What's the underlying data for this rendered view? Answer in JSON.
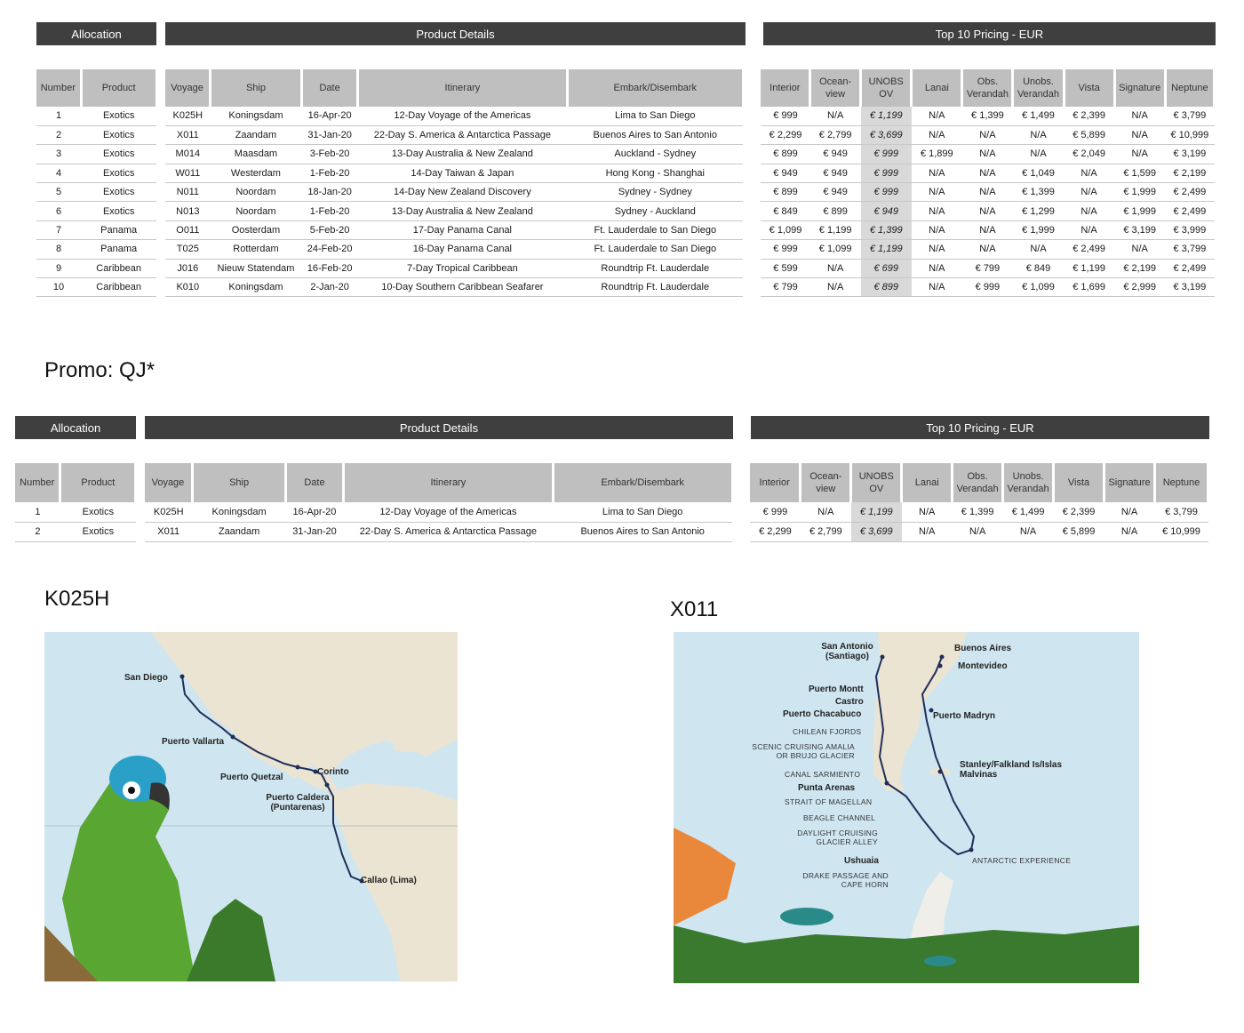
{
  "headers": {
    "allocation": "Allocation",
    "product_details": "Product Details",
    "pricing": "Top 10 Pricing - EUR"
  },
  "columns": {
    "allocation": [
      "Number",
      "Product"
    ],
    "product": [
      "Voyage",
      "Ship",
      "Date",
      "Itinerary",
      "Embark/Disembark"
    ],
    "pricing": [
      "Interior",
      "Ocean-view",
      "UNOBS OV",
      "Lanai",
      "Obs. Verandah",
      "Unobs. Verandah",
      "Vista",
      "Signature",
      "Neptune"
    ]
  },
  "top10": [
    [
      "1",
      "Exotics",
      "K025H",
      "Koningsdam",
      "16-Apr-20",
      "12-Day Voyage of the Americas",
      "Lima to San Diego",
      "€ 999",
      "N/A",
      "€ 1,199",
      "N/A",
      "€ 1,399",
      "€ 1,499",
      "€ 2,399",
      "N/A",
      "€ 3,799"
    ],
    [
      "2",
      "Exotics",
      "X011",
      "Zaandam",
      "31-Jan-20",
      "22-Day S. America & Antarctica Passage",
      "Buenos Aires to San Antonio",
      "€ 2,299",
      "€ 2,799",
      "€ 3,699",
      "N/A",
      "N/A",
      "N/A",
      "€ 5,899",
      "N/A",
      "€ 10,999"
    ],
    [
      "3",
      "Exotics",
      "M014",
      "Maasdam",
      "3-Feb-20",
      "13-Day Australia & New Zealand",
      "Auckland - Sydney",
      "€ 899",
      "€ 949",
      "€ 999",
      "€ 1,899",
      "N/A",
      "N/A",
      "€ 2,049",
      "N/A",
      "€ 3,199"
    ],
    [
      "4",
      "Exotics",
      "W011",
      "Westerdam",
      "1-Feb-20",
      "14-Day Taiwan & Japan",
      "Hong Kong - Shanghai",
      "€ 949",
      "€ 949",
      "€ 999",
      "N/A",
      "N/A",
      "€ 1,049",
      "N/A",
      "€ 1,599",
      "€ 2,199"
    ],
    [
      "5",
      "Exotics",
      "N011",
      "Noordam",
      "18-Jan-20",
      "14-Day New Zealand Discovery",
      "Sydney - Sydney",
      "€ 899",
      "€ 949",
      "€ 999",
      "N/A",
      "N/A",
      "€ 1,399",
      "N/A",
      "€ 1,999",
      "€ 2,499"
    ],
    [
      "6",
      "Exotics",
      "N013",
      "Noordam",
      "1-Feb-20",
      "13-Day Australia & New Zealand",
      "Sydney - Auckland",
      "€ 849",
      "€ 899",
      "€ 949",
      "N/A",
      "N/A",
      "€ 1,299",
      "N/A",
      "€ 1,999",
      "€ 2,499"
    ],
    [
      "7",
      "Panama",
      "O011",
      "Oosterdam",
      "5-Feb-20",
      "17-Day Panama Canal",
      "Ft. Lauderdale to San Diego",
      "€ 1,099",
      "€ 1,199",
      "€ 1,399",
      "N/A",
      "N/A",
      "€ 1,999",
      "N/A",
      "€ 3,199",
      "€ 3,999"
    ],
    [
      "8",
      "Panama",
      "T025",
      "Rotterdam",
      "24-Feb-20",
      "16-Day Panama Canal",
      "Ft. Lauderdale to San Diego",
      "€ 999",
      "€ 1,099",
      "€ 1,199",
      "N/A",
      "N/A",
      "N/A",
      "€ 2,499",
      "N/A",
      "€ 3,799"
    ],
    [
      "9",
      "Caribbean",
      "J016",
      "Nieuw Statendam",
      "16-Feb-20",
      "7-Day Tropical Caribbean",
      "Roundtrip Ft. Lauderdale",
      "€ 599",
      "N/A",
      "€ 699",
      "N/A",
      "€ 799",
      "€ 849",
      "€ 1,199",
      "€ 2,199",
      "€ 2,499"
    ],
    [
      "10",
      "Caribbean",
      "K010",
      "Koningsdam",
      "2-Jan-20",
      "10-Day Southern Caribbean Seafarer",
      "Roundtrip Ft. Lauderdale",
      "€ 799",
      "N/A",
      "€ 899",
      "N/A",
      "€ 999",
      "€ 1,099",
      "€ 1,699",
      "€ 2,999",
      "€ 3,199"
    ]
  ],
  "promo": {
    "title": "Promo: QJ*",
    "rows": [
      [
        "1",
        "Exotics",
        "K025H",
        "Koningsdam",
        "16-Apr-20",
        "12-Day Voyage of the Americas",
        "Lima to San Diego",
        "€ 999",
        "N/A",
        "€ 1,199",
        "N/A",
        "€ 1,399",
        "€ 1,499",
        "€ 2,399",
        "N/A",
        "€ 3,799"
      ],
      [
        "2",
        "Exotics",
        "X011",
        "Zaandam",
        "31-Jan-20",
        "22-Day S. America & Antarctica Passage",
        "Buenos Aires to San Antonio",
        "€ 2,299",
        "€ 2,799",
        "€ 3,699",
        "N/A",
        "N/A",
        "N/A",
        "€ 5,899",
        "N/A",
        "€ 10,999"
      ]
    ]
  },
  "maps": {
    "k025h": {
      "title": "K025H",
      "ports": [
        "San Diego",
        "Puerto Vallarta",
        "Puerto Quetzal",
        "Corinto",
        "Puerto Caldera (Puntarenas)",
        "Callao (Lima)"
      ]
    },
    "x011": {
      "title": "X011",
      "ports_bold": [
        "San Antonio (Santiago)",
        "Buenos Aires",
        "Montevideo",
        "Puerto Montt",
        "Castro",
        "Puerto Chacabuco",
        "Puerto Madryn",
        "Stanley/Falkland Is/Islas Malvinas",
        "Punta Arenas",
        "Ushuaia"
      ],
      "ports_scenic": [
        "CHILEAN FJORDS",
        "SCENIC CRUISING AMALIA OR BRUJO GLACIER",
        "CANAL SARMIENTO",
        "STRAIT OF MAGELLAN",
        "BEAGLE CHANNEL",
        "DAYLIGHT CRUISING GLACIER ALLEY",
        "ANTARCTIC EXPERIENCE",
        "DRAKE PASSAGE AND CAPE HORN"
      ]
    }
  },
  "colors": {
    "band": "#3f3f3f",
    "header": "#bfbfbf",
    "highlight": "#d9d9d9",
    "route": "#1f2f5a",
    "sea": "#cfe6f0",
    "land": "#ece4d2"
  }
}
